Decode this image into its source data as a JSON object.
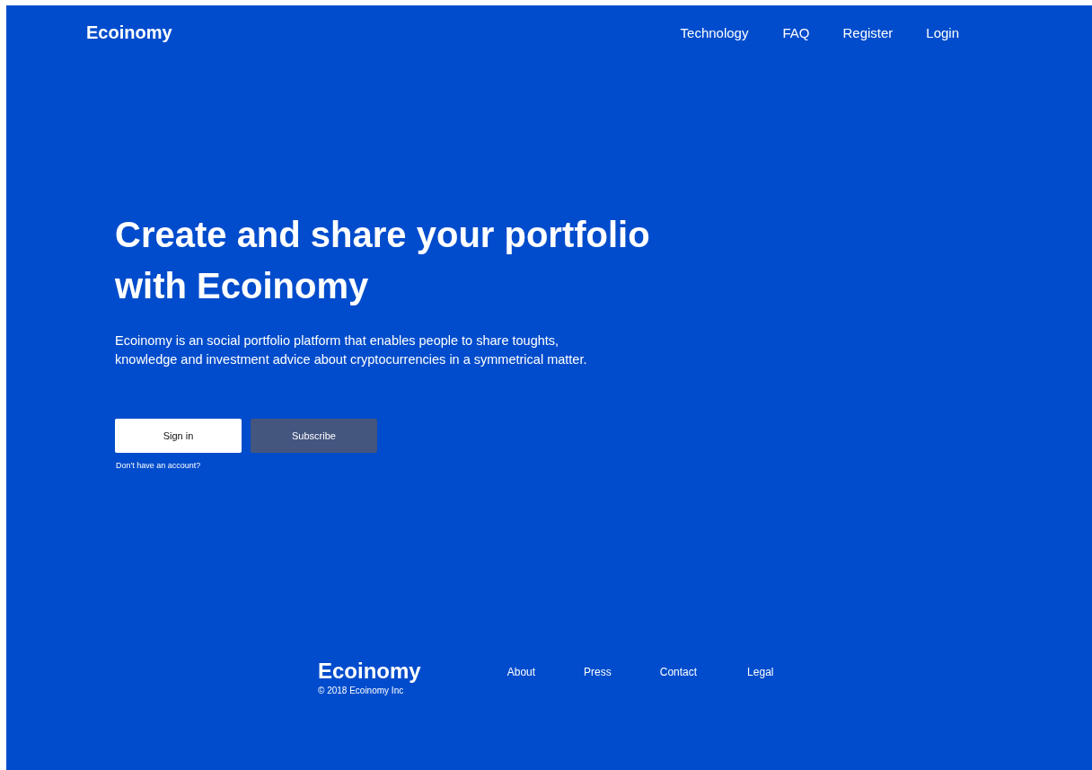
{
  "header": {
    "logo": "Ecoinomy",
    "nav": [
      "Technology",
      "FAQ",
      "Register",
      "Login"
    ]
  },
  "hero": {
    "title": "Create and share your portfolio with Ecoinomy",
    "description": "Ecoinomy is an social portfolio platform that enables people to share toughts, knowledge and investment advice about cryptocurrencies in a symmetrical matter.",
    "buttons": [
      {
        "label": "Sign in",
        "kind": "primary"
      },
      {
        "label": "Subscribe",
        "kind": "secondary"
      }
    ],
    "note": "Don't have an account?"
  },
  "footer": {
    "logo": "Ecoinomy",
    "copyright": "© 2018 Ecoinomy Inc",
    "links": [
      "About",
      "Press",
      "Contact",
      "Legal"
    ]
  }
}
